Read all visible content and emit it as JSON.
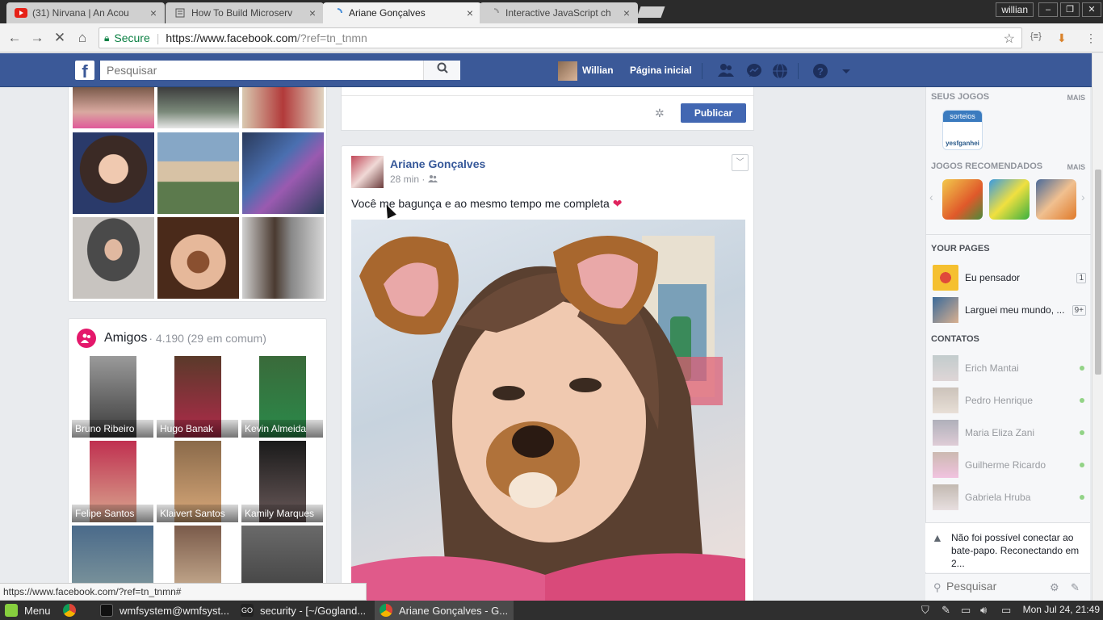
{
  "browser": {
    "tabs": [
      {
        "title": "(31) Nirvana | An Acou",
        "icon": "youtube-icon",
        "active": false
      },
      {
        "title": "How To Build Microserv",
        "icon": "document-icon",
        "active": false
      },
      {
        "title": "Ariane Gonçalves",
        "icon": "loading-icon",
        "active": true
      },
      {
        "title": "Interactive JavaScript ch",
        "icon": "loading-icon",
        "active": false
      }
    ],
    "user_badge": "willian",
    "secure_label": "Secure",
    "url_host": "https://www.facebook.com",
    "url_path": "/?ref=tn_tnmn",
    "status_url": "https://www.facebook.com/?ref=tn_tnmn#"
  },
  "fb_header": {
    "search_placeholder": "Pesquisar",
    "user_name": "Willian",
    "home_label": "Página inicial"
  },
  "friends": {
    "title": "Amigos",
    "count": "· 4.190 (29 em comum)",
    "list": [
      {
        "name": "Bruno Ribeiro"
      },
      {
        "name": "Hugo Banak"
      },
      {
        "name": "Kevin Almeida"
      },
      {
        "name": "Felipe Santos"
      },
      {
        "name": "Klaivert Santos"
      },
      {
        "name": "Kamily Marques"
      },
      {
        "name": ""
      },
      {
        "name": ""
      },
      {
        "name": ""
      }
    ]
  },
  "composer": {
    "publish_label": "Publicar"
  },
  "post": {
    "author": "Ariane Gonçalves",
    "time": "28 min ·",
    "text": "Você me bagunça e ao mesmo tempo me completa",
    "heart": "❤"
  },
  "sidebar": {
    "games_title": "SEUS JOGOS",
    "games_more": "MAIS",
    "game_logo_top": "sorteios",
    "game_logo_bottom": "yesfganhei",
    "recommended_title": "JOGOS RECOMENDADOS",
    "recommended_more": "MAIS",
    "pages_title": "YOUR PAGES",
    "pages": [
      {
        "name": "Eu pensador",
        "badge": "1"
      },
      {
        "name": "Larguei meu mundo, ...",
        "badge": "9+"
      }
    ],
    "contacts_title": "CONTATOS",
    "contacts": [
      {
        "name": "Erich Mantai"
      },
      {
        "name": "Pedro Henrique"
      },
      {
        "name": "Maria Eliza Zani"
      },
      {
        "name": "Guilherme Ricardo"
      },
      {
        "name": "Gabriela Hruba"
      }
    ],
    "chat_error": "Não foi possível conectar ao bate-papo. Reconectando em 2...",
    "chat_search_placeholder": "Pesquisar"
  },
  "taskbar": {
    "menu_label": "Menu",
    "tasks": [
      {
        "label": "wmfsystem@wmfsyst..."
      },
      {
        "label": "security - [~/Gogland..."
      },
      {
        "label": "Ariane Gonçalves - G..."
      }
    ],
    "clock": "Mon Jul 24, 21:49"
  },
  "colors": {
    "fb_blue": "#3b5998",
    "link_blue": "#365899",
    "publish_blue": "#4267b2",
    "online_green": "#42b72a",
    "friends_icon_pink": "#e4186b"
  }
}
